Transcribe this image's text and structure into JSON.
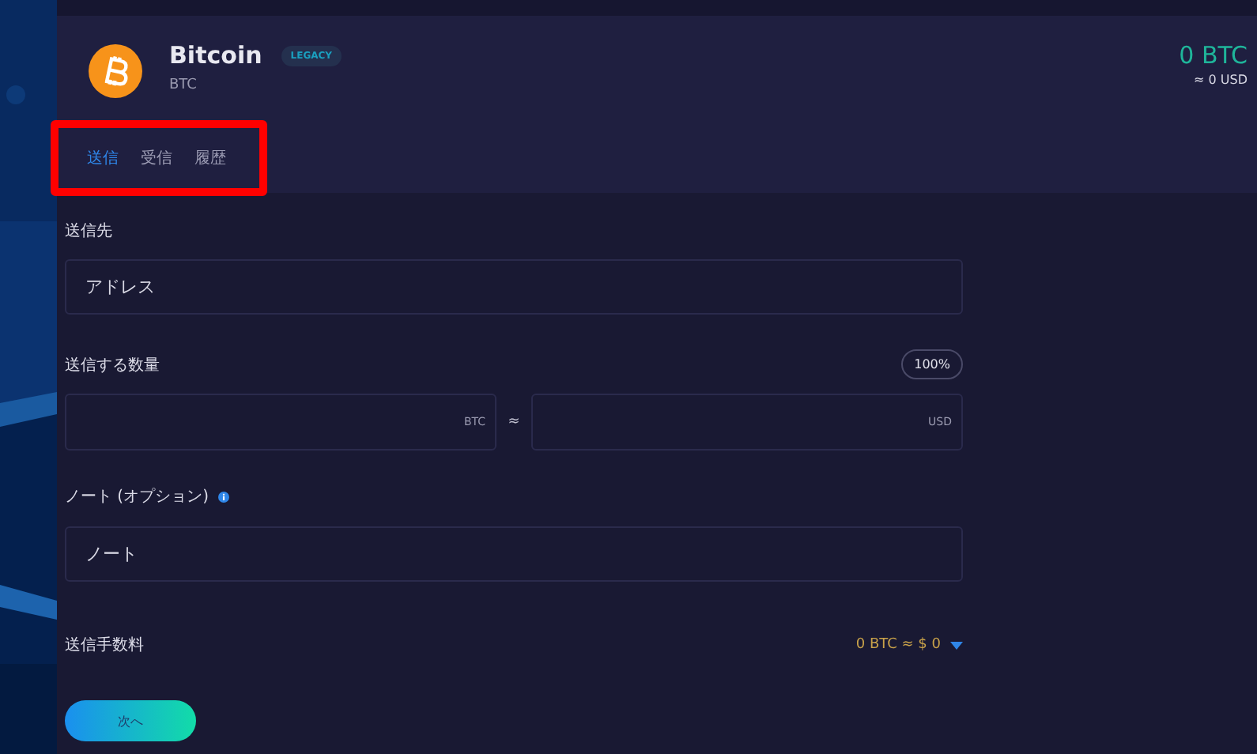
{
  "asset": {
    "name": "Bitcoin",
    "badge": "LEGACY",
    "ticker": "BTC",
    "balance": "0 BTC",
    "balance_fiat": "≈ 0 USD"
  },
  "tabs": [
    {
      "label": "送信",
      "selected": true
    },
    {
      "label": "受信",
      "selected": false
    },
    {
      "label": "履歴",
      "selected": false
    }
  ],
  "highlight_tabs": true,
  "form": {
    "recipient_label": "送信先",
    "recipient_placeholder": "アドレス",
    "amount_label": "送信する数量",
    "max_button": "100%",
    "amount_unit": "BTC",
    "approx": "≈",
    "fiat_unit": "USD",
    "note_label": "ノート (オプション)",
    "note_placeholder": "ノート",
    "fee_label": "送信手数料",
    "fee_value": "0 BTC ≈ $ 0",
    "next_button": "次へ"
  }
}
